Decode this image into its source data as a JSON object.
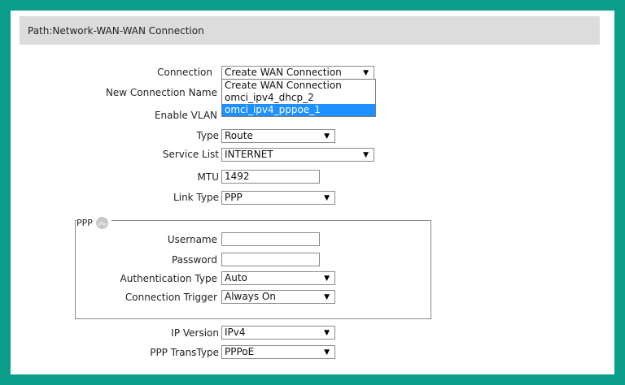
{
  "path": "Path:Network-WAN-WAN Connection",
  "form": {
    "connection": {
      "label": "Connection",
      "value": "Create WAN Connection"
    },
    "connection_options": [
      "Create WAN Connection",
      "omci_ipv4_dhcp_2",
      "omci_ipv4_pppoe_1"
    ],
    "connection_highlighted": "omci_ipv4_pppoe_1",
    "new_connection_name": {
      "label": "New Connection Name"
    },
    "enable_vlan": {
      "label": "Enable VLAN"
    },
    "type": {
      "label": "Type",
      "value": "Route"
    },
    "service_list": {
      "label": "Service List",
      "value": "INTERNET"
    },
    "mtu": {
      "label": "MTU",
      "value": "1492"
    },
    "link_type": {
      "label": "Link Type",
      "value": "PPP"
    },
    "ppp": {
      "legend": "PPP",
      "username": {
        "label": "Username",
        "value": ""
      },
      "password": {
        "label": "Password",
        "value": ""
      },
      "auth_type": {
        "label": "Authentication Type",
        "value": "Auto"
      },
      "conn_trigger": {
        "label": "Connection Trigger",
        "value": "Always On"
      }
    },
    "ip_version": {
      "label": "IP Version",
      "value": "IPv4"
    },
    "ppp_transtype": {
      "label": "PPP TransType",
      "value": "PPPoE"
    }
  },
  "icons": {
    "collapse": "double-chevron-up-icon",
    "dropdown_arrow": "triangle-down-icon"
  },
  "colors": {
    "frame": "#0a9e8a",
    "highlight": "#1e90ff",
    "pathbar": "#dcdcdc"
  }
}
